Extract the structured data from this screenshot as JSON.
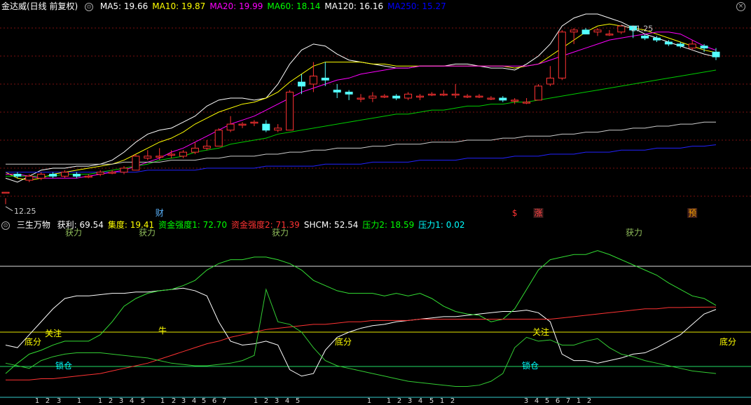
{
  "top": {
    "title": "金达威(日线 前复权)",
    "indicators": [
      {
        "label": "MA5: 19.66",
        "color": "#ffffff"
      },
      {
        "label": "MA10: 19.87",
        "color": "#ffff00"
      },
      {
        "label": "MA20: 19.99",
        "color": "#ff00ff"
      },
      {
        "label": "MA60: 18.14",
        "color": "#00ff00"
      },
      {
        "label": "MA120: 16.16",
        "color": "#ffffff"
      },
      {
        "label": "MA250: 15.27",
        "color": "#0000ff"
      }
    ],
    "high_label": "21.25",
    "low_label": "12.25",
    "markers": [
      {
        "text": "财",
        "color": "#5ab4ff"
      },
      {
        "text": "$",
        "color": "#ff3333"
      },
      {
        "text": "涨",
        "color": "#ff4444"
      },
      {
        "text": "预",
        "color": "#ffa500"
      }
    ]
  },
  "bottom": {
    "title": "三生万物",
    "indicators": [
      {
        "label": "获利: 69.54",
        "color": "#ffffff"
      },
      {
        "label": "集度: 19.41",
        "color": "#ffff00"
      },
      {
        "label": "资金强度1: 72.70",
        "color": "#00ff00"
      },
      {
        "label": "资金强度2: 71.39",
        "color": "#ff3333"
      },
      {
        "label": "SHCM: 52.54",
        "color": "#ffffff"
      },
      {
        "label": "压力2: 18.59",
        "color": "#00ff00"
      },
      {
        "label": "压力1: 0.02",
        "color": "#00ffff"
      }
    ],
    "annotations": [
      {
        "text": "获力",
        "color": "#8fbc5a"
      },
      {
        "text": "获力",
        "color": "#8fbc5a"
      },
      {
        "text": "获力",
        "color": "#8fbc5a"
      },
      {
        "text": "获力",
        "color": "#8fbc5a"
      },
      {
        "text": "关注",
        "color": "#ffff00"
      },
      {
        "text": "底分",
        "color": "#ffff00"
      },
      {
        "text": "牛",
        "color": "#ffff00"
      },
      {
        "text": "底分",
        "color": "#ffff00"
      },
      {
        "text": "关注",
        "color": "#ffff00"
      },
      {
        "text": "底分",
        "color": "#ffff00"
      },
      {
        "text": "锁仓",
        "color": "#00ffff"
      },
      {
        "text": "锁仓",
        "color": "#00ffff"
      }
    ],
    "counters": [
      "1",
      "2",
      "3",
      "1",
      "1",
      "2",
      "3",
      "4",
      "5",
      "1",
      "2",
      "3",
      "4",
      "5",
      "6",
      "7",
      "1",
      "2",
      "3",
      "4",
      "5",
      "1",
      "1",
      "2",
      "3",
      "4",
      "5",
      "1",
      "2",
      "3",
      "4",
      "5",
      "6",
      "7",
      "1",
      "2"
    ]
  },
  "chart_data": [
    {
      "type": "candlestick",
      "series": [
        {
          "name": "MA5",
          "values": [
            13.6,
            13.4,
            13.7,
            14.0,
            14.1,
            14.1,
            14.2,
            14.2,
            14.3,
            14.5,
            14.9,
            15.4,
            15.8,
            16.0,
            16.1,
            16.4,
            16.7,
            17.2,
            17.5,
            17.6,
            17.6,
            17.5,
            17.6,
            18.3,
            19.3,
            20.0,
            20.3,
            20.2,
            19.8,
            19.5,
            19.4,
            19.3,
            19.2,
            19.1,
            19.1,
            19.2,
            19.2,
            19.2,
            19.3,
            19.3,
            19.2,
            19.1,
            19.1,
            19.0,
            19.3,
            19.7,
            20.3,
            21.2,
            21.6,
            21.8,
            21.8,
            21.6,
            21.4,
            21.1,
            20.8,
            20.6,
            20.4,
            20.2,
            20.0,
            19.8,
            19.66
          ]
        },
        {
          "name": "MA10",
          "values": [
            13.9,
            13.6,
            13.5,
            13.6,
            13.8,
            13.9,
            14.0,
            14.1,
            14.2,
            14.3,
            14.5,
            14.8,
            15.1,
            15.4,
            15.6,
            15.9,
            16.3,
            16.6,
            16.9,
            17.1,
            17.3,
            17.4,
            17.6,
            17.9,
            18.4,
            18.8,
            19.2,
            19.4,
            19.4,
            19.4,
            19.4,
            19.3,
            19.3,
            19.2,
            19.2,
            19.2,
            19.2,
            19.2,
            19.2,
            19.2,
            19.2,
            19.2,
            19.2,
            19.1,
            19.2,
            19.3,
            19.7,
            20.1,
            20.5,
            20.9,
            21.2,
            21.3,
            21.2,
            21.1,
            21.0,
            20.8,
            20.6,
            20.4,
            20.2,
            20.0,
            19.87
          ]
        },
        {
          "name": "MA20",
          "values": [
            13.8,
            13.8,
            13.7,
            13.6,
            13.6,
            13.6,
            13.6,
            13.7,
            13.8,
            13.9,
            14.0,
            14.2,
            14.4,
            14.6,
            14.9,
            15.1,
            15.4,
            15.7,
            16.0,
            16.3,
            16.5,
            16.7,
            17.0,
            17.3,
            17.6,
            17.9,
            18.1,
            18.3,
            18.5,
            18.6,
            18.8,
            18.9,
            19.0,
            19.1,
            19.1,
            19.2,
            19.2,
            19.2,
            19.2,
            19.2,
            19.2,
            19.2,
            19.2,
            19.2,
            19.2,
            19.3,
            19.5,
            19.7,
            19.9,
            20.1,
            20.3,
            20.5,
            20.6,
            20.7,
            20.8,
            20.9,
            20.9,
            20.8,
            20.5,
            20.2,
            19.99
          ]
        },
        {
          "name": "MA60",
          "values": [
            13.7,
            13.7,
            13.7,
            13.7,
            13.7,
            13.8,
            13.8,
            13.8,
            13.9,
            14.0,
            14.1,
            14.2,
            14.3,
            14.5,
            14.6,
            14.7,
            14.9,
            15.0,
            15.1,
            15.3,
            15.4,
            15.5,
            15.6,
            15.8,
            15.9,
            16.0,
            16.1,
            16.2,
            16.3,
            16.4,
            16.5,
            16.6,
            16.7,
            16.8,
            16.8,
            16.9,
            17.0,
            17.0,
            17.1,
            17.2,
            17.2,
            17.3,
            17.3,
            17.4,
            17.4,
            17.5,
            17.6,
            17.7,
            17.8,
            17.9,
            18.0,
            18.1,
            18.2,
            18.3,
            18.4,
            18.5,
            18.6,
            18.7,
            18.8,
            18.9,
            19.0
          ]
        },
        {
          "name": "MA120",
          "values": [
            14.3,
            14.3,
            14.3,
            14.3,
            14.3,
            14.3,
            14.3,
            14.3,
            14.3,
            14.3,
            14.4,
            14.4,
            14.4,
            14.4,
            14.5,
            14.5,
            14.5,
            14.6,
            14.6,
            14.7,
            14.7,
            14.7,
            14.8,
            14.8,
            14.9,
            14.9,
            15.0,
            15.0,
            15.1,
            15.1,
            15.1,
            15.2,
            15.2,
            15.3,
            15.3,
            15.3,
            15.4,
            15.4,
            15.4,
            15.5,
            15.5,
            15.5,
            15.6,
            15.6,
            15.7,
            15.7,
            15.7,
            15.8,
            15.8,
            15.9,
            15.9,
            16.0,
            16.0,
            16.1,
            16.1,
            16.2,
            16.2,
            16.3,
            16.3,
            16.4,
            16.4
          ]
        },
        {
          "name": "MA250",
          "values": [
            13.9,
            13.9,
            13.9,
            13.9,
            13.9,
            13.9,
            13.9,
            13.9,
            13.9,
            13.9,
            13.9,
            13.9,
            14.0,
            14.0,
            14.0,
            14.0,
            14.0,
            14.1,
            14.1,
            14.1,
            14.1,
            14.1,
            14.2,
            14.2,
            14.2,
            14.2,
            14.2,
            14.3,
            14.3,
            14.3,
            14.3,
            14.4,
            14.4,
            14.4,
            14.4,
            14.5,
            14.5,
            14.5,
            14.5,
            14.6,
            14.6,
            14.6,
            14.6,
            14.7,
            14.7,
            14.7,
            14.8,
            14.8,
            14.8,
            14.9,
            14.9,
            14.9,
            15.0,
            15.0,
            15.0,
            15.1,
            15.1,
            15.1,
            15.2,
            15.2,
            15.27
          ]
        }
      ],
      "candles": [
        [
          12.9,
          12.9,
          12.3,
          12.6
        ],
        [
          13.8,
          13.7,
          13.9,
          13.6
        ],
        [
          13.5,
          13.7,
          13.8,
          13.4
        ],
        [
          13.6,
          13.8,
          13.9,
          13.5
        ],
        [
          13.8,
          13.7,
          13.9,
          13.6
        ],
        [
          13.7,
          13.9,
          14.0,
          13.6
        ],
        [
          13.8,
          13.7,
          13.9,
          13.6
        ],
        [
          13.7,
          13.7,
          13.8,
          13.6
        ],
        [
          13.8,
          13.9,
          14.0,
          13.7
        ],
        [
          13.9,
          13.9,
          14.0,
          13.8
        ],
        [
          13.9,
          14.1,
          14.2,
          13.8
        ],
        [
          14.0,
          14.7,
          14.8,
          14.0
        ],
        [
          14.6,
          14.7,
          15.0,
          14.5
        ],
        [
          14.7,
          14.7,
          15.1,
          14.5
        ],
        [
          14.8,
          14.8,
          15.0,
          14.6
        ],
        [
          14.7,
          14.9,
          15.0,
          14.6
        ],
        [
          14.9,
          15.1,
          15.4,
          14.8
        ],
        [
          15.1,
          15.2,
          15.5,
          15.0
        ],
        [
          15.2,
          16.0,
          16.1,
          15.2
        ],
        [
          16.0,
          16.3,
          16.7,
          15.9
        ],
        [
          16.3,
          16.3,
          16.4,
          16.1
        ],
        [
          16.4,
          16.4,
          16.5,
          16.2
        ],
        [
          16.3,
          16.0,
          16.5,
          15.9
        ],
        [
          16.0,
          16.1,
          16.3,
          15.9
        ],
        [
          16.0,
          17.9,
          18.0,
          16.0
        ],
        [
          18.4,
          18.2,
          18.8,
          17.8
        ],
        [
          18.3,
          18.7,
          19.4,
          17.9
        ],
        [
          18.6,
          18.5,
          19.4,
          18.2
        ],
        [
          18.0,
          17.9,
          18.3,
          17.6
        ],
        [
          17.9,
          17.8,
          18.0,
          17.5
        ],
        [
          17.6,
          17.6,
          17.8,
          17.4
        ],
        [
          17.6,
          17.7,
          17.9,
          17.4
        ],
        [
          17.7,
          17.7,
          17.8,
          17.6
        ],
        [
          17.7,
          17.6,
          17.8,
          17.5
        ],
        [
          17.6,
          17.8,
          17.9,
          17.5
        ],
        [
          17.7,
          17.7,
          17.8,
          17.5
        ],
        [
          17.8,
          17.8,
          17.9,
          17.7
        ],
        [
          17.8,
          17.8,
          18.0,
          17.7
        ],
        [
          17.8,
          17.8,
          18.3,
          17.6
        ],
        [
          17.7,
          17.7,
          17.8,
          17.6
        ],
        [
          17.7,
          17.7,
          17.8,
          17.6
        ],
        [
          17.6,
          17.6,
          17.7,
          17.5
        ],
        [
          17.6,
          17.5,
          17.7,
          17.4
        ],
        [
          17.5,
          17.5,
          17.6,
          17.3
        ],
        [
          17.4,
          17.4,
          17.6,
          17.3
        ],
        [
          17.5,
          18.2,
          18.3,
          17.5
        ],
        [
          18.3,
          18.6,
          19.2,
          18.2
        ],
        [
          18.6,
          20.9,
          21.0,
          18.5
        ],
        [
          20.9,
          21.0,
          21.1,
          20.3
        ],
        [
          21.0,
          20.8,
          21.1,
          20.8
        ],
        [
          20.9,
          21.0,
          21.1,
          20.7
        ],
        [
          20.8,
          20.8,
          21.0,
          20.7
        ],
        [
          20.9,
          21.2,
          21.25,
          20.8
        ],
        [
          21.2,
          21.0,
          21.1,
          20.6
        ],
        [
          20.7,
          20.6,
          20.8,
          20.5
        ],
        [
          20.6,
          20.5,
          20.7,
          20.4
        ],
        [
          20.4,
          20.3,
          20.5,
          20.2
        ],
        [
          20.3,
          20.2,
          20.4,
          20.1
        ],
        [
          20.1,
          20.3,
          20.5,
          20.0
        ],
        [
          20.2,
          20.1,
          20.3,
          19.9
        ],
        [
          19.9,
          19.66,
          20.1,
          19.5
        ]
      ]
    },
    {
      "type": "line",
      "series": [
        {
          "name": "获利",
          "values": [
            42,
            40,
            50,
            60,
            70,
            78,
            80,
            80,
            81,
            82,
            82,
            83,
            83,
            84,
            85,
            86,
            84,
            80,
            60,
            45,
            42,
            43,
            45,
            42,
            23,
            18,
            20,
            38,
            48,
            52,
            55,
            57,
            58,
            60,
            61,
            62,
            63,
            64,
            64,
            65,
            66,
            67,
            68,
            68,
            69,
            67,
            60,
            35,
            30,
            30,
            28,
            30,
            32,
            35,
            36,
            40,
            45,
            50,
            58,
            66,
            69.54
          ]
        },
        {
          "name": "资金强度1",
          "values": [
            20,
            28,
            35,
            38,
            42,
            45,
            45,
            45,
            50,
            60,
            72,
            78,
            82,
            84,
            85,
            88,
            92,
            100,
            105,
            108,
            108,
            110,
            110,
            108,
            105,
            100,
            92,
            88,
            84,
            82,
            82,
            82,
            80,
            82,
            80,
            82,
            78,
            72,
            68,
            66,
            65,
            60,
            62,
            70,
            85,
            100,
            108,
            110,
            112,
            112,
            115,
            112,
            108,
            104,
            100,
            96,
            90,
            85,
            80,
            78,
            72.7
          ]
        },
        {
          "name": "资金强度2",
          "values": [
            15,
            15,
            15,
            16,
            16,
            17,
            18,
            19,
            20,
            22,
            24,
            26,
            28,
            31,
            34,
            37,
            40,
            43,
            45,
            48,
            50,
            52,
            54,
            55,
            56,
            57,
            58,
            58,
            59,
            60,
            60,
            61,
            61,
            61,
            61,
            62,
            62,
            62,
            62,
            62,
            62,
            62,
            62,
            62,
            62,
            62,
            62,
            63,
            64,
            65,
            66,
            67,
            68,
            69,
            70,
            70,
            71,
            71,
            71.2,
            71.3,
            71.39
          ]
        }
      ]
    }
  ]
}
